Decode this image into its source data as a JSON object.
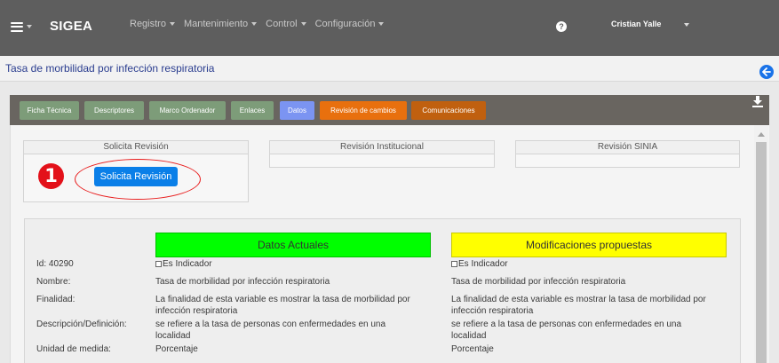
{
  "navbar": {
    "brand": "SIGEA",
    "menu": [
      {
        "label": "Registro"
      },
      {
        "label": "Mantenimiento"
      },
      {
        "label": "Control"
      },
      {
        "label": "Configuración"
      }
    ],
    "help_glyph": "?",
    "user_name": "Cristian Yalle",
    "icons": {
      "menu": "hamburger-icon",
      "help": "help-icon",
      "dropdown": "caret-down-icon"
    }
  },
  "page": {
    "title": "Tasa de morbilidad por infección respiratoria",
    "back_icon": "arrow-left-icon",
    "download_icon": "download-icon"
  },
  "tabs": [
    {
      "label": "Ficha Técnica",
      "color": "#7d9c79"
    },
    {
      "label": "Descriptores",
      "color": "#7d9c79"
    },
    {
      "label": "Marco Ordenador",
      "color": "#7d9c79"
    },
    {
      "label": "Enlaces",
      "color": "#7d9c79"
    },
    {
      "label": "Datos",
      "color": "#7b94f2"
    },
    {
      "label": "Revisión de cambios",
      "color": "#e8700e"
    },
    {
      "label": "Comunicaciones",
      "color": "#c0600f"
    }
  ],
  "revision": {
    "solicita_header": "Solicita Revisión",
    "institucional_header": "Revisión Institucional",
    "sinia_header": "Revisión SINIA",
    "solicita_button": "Solicita Revisión",
    "step_number": "1",
    "button_color": "#0a7fe8",
    "highlight_color": "#e81b1b"
  },
  "details": {
    "current_header": "Datos Actuales",
    "current_color": "#00ff00",
    "proposed_header": "Modificaciones propuestas",
    "proposed_color": "#ffff00",
    "id_label": "Id: 40290",
    "checkbox_label": "Es Indicador",
    "rows": [
      {
        "label": "Nombre:",
        "current": "Tasa de morbilidad por infección respiratoria",
        "proposed": "Tasa de morbilidad por infección respiratoria"
      },
      {
        "label": "Finalidad:",
        "current_line1": "La finalidad de esta variable es mostrar la tasa de morbilidad por",
        "current_line2": "infección respiratoria",
        "proposed_line1": "La finalidad de esta variable es mostrar la tasa de morbilidad por",
        "proposed_line2": "infección respiratoria"
      },
      {
        "label": "Descripción/Definición:",
        "current_line1": "se refiere a la tasa de personas con enfermedades en una",
        "current_line2": "localidad",
        "proposed_line1": "se refiere a la tasa de personas con enfermedades en una",
        "proposed_line2": "localidad"
      },
      {
        "label": "Unidad de medida:",
        "current": "Porcentaje",
        "proposed": "Porcentaje"
      }
    ]
  }
}
